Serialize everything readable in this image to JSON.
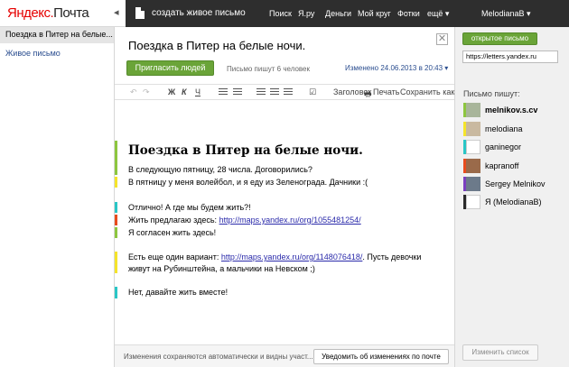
{
  "header": {
    "logo_part1": "Яндекс",
    "logo_dot": ".",
    "logo_part2": "Почта",
    "create_label": "создать живое письмо",
    "nav": [
      "Поиск",
      "Я.ру",
      "Деньги",
      "Мой круг",
      "Фотки",
      "ещё ▾"
    ],
    "user": "MelodianaB ▾"
  },
  "sidebar": {
    "active_item": "Поездка в Питер на белые...",
    "link_item": "Живое письмо"
  },
  "document": {
    "title": "Поездка в Питер на белые ночи.",
    "close": "✕",
    "invite_label": "Пригласить людей",
    "writers_count": "Письмо пишут 6 человек",
    "changed": "Изменено 24.06.2013 в 20:43 ▾"
  },
  "toolbar": {
    "undo": "↶",
    "redo": "↷",
    "bold": "Ж",
    "italic": "К",
    "underline": "Ч",
    "headings": "Заголовок",
    "print": "Печать",
    "save_as": "Сохранить как ▾"
  },
  "content": {
    "heading": "Поездка в Питер на белые ночи.",
    "l1": "В следующую пятницу, 28 числа. Договорились?",
    "l2": "В пятницу у меня волейбол, и я еду из Зеленограда. Дачники :(",
    "l3": "Отлично! А где мы будем жить?!",
    "l4_pre": "Жить предлагаю здесь: ",
    "l4_link": "http://maps.yandex.ru/org/1055481254/",
    "l5": "Я согласен жить здесь!",
    "l6_pre": "Есть еще один вариант: ",
    "l6_link": "http://maps.yandex.ru/org/1148076418/",
    "l6_post": ". Пусть девочки",
    "l7": "живут на Рубинштейна, а мальчики на Невском ;)",
    "l8": "Нет, давайте жить вместе!"
  },
  "footer": {
    "text": "Изменения сохраняются автоматически и видны участ...",
    "notify_label": "Уведомить об изменениях по почте"
  },
  "right_panel": {
    "open_letter_label": "открытое письмо",
    "url": "https://letters.yandex.ru",
    "writers_title": "Письмо пишут:",
    "writers": [
      {
        "name": "melnikov.s.cv",
        "color": "#8dc63f"
      },
      {
        "name": "melodiana",
        "color": "#f5e42a"
      },
      {
        "name": "ganinegor",
        "color": "#29c6c6"
      },
      {
        "name": "kapranoff",
        "color": "#e84c1e"
      },
      {
        "name": "Sergey Melnikov",
        "color": "#7b3fbf"
      },
      {
        "name": "Я (MelodianaB)",
        "color": "#2a2a2a"
      }
    ],
    "change_list_label": "Изменить список"
  },
  "colors": {
    "topbar": "#2e2e2e",
    "green_button": "#6aa438",
    "link": "#2a4d8f"
  }
}
